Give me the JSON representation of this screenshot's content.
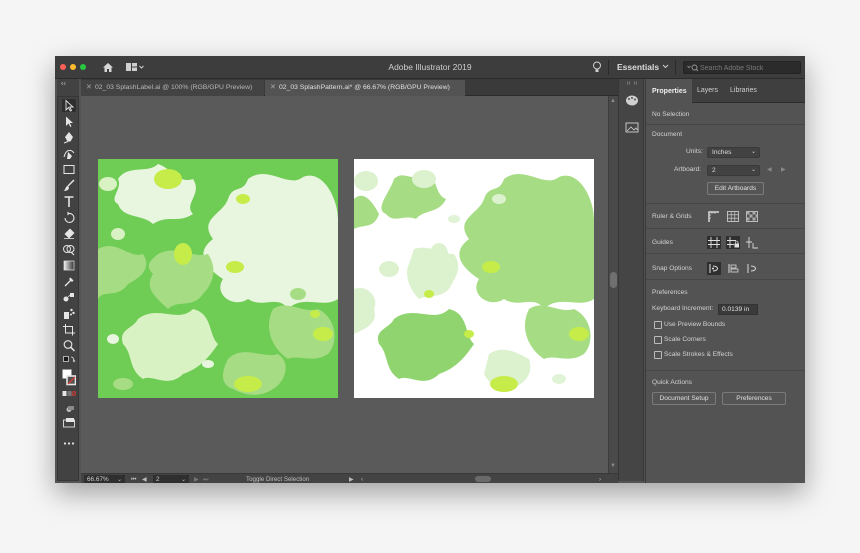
{
  "window": {
    "title": "Adobe Illustrator 2019",
    "workspace": "Essentials",
    "stock_search_placeholder": "Search Adobe Stock"
  },
  "tabs": [
    {
      "label": "02_03 SplashLabel.ai @ 100% (RGB/GPU Preview)",
      "active": false
    },
    {
      "label": "02_03 SplashPattern.ai* @ 66.67% (RGB/GPU Preview)",
      "active": true
    }
  ],
  "tools": [
    "selection-tool",
    "direct-selection-tool",
    "pen-tool",
    "curvature-tool",
    "rectangle-tool",
    "paintbrush-tool",
    "type-tool",
    "rotate-tool",
    "eraser-tool",
    "shape-builder-tool",
    "gradient-tool",
    "eyedropper-tool",
    "blend-tool",
    "symbol-sprayer-tool",
    "artboard-tool",
    "zoom-tool",
    "swap-fill-stroke",
    "fill-stroke-swatch",
    "color-mode-buttons",
    "draw-mode",
    "screen-mode",
    "edit-toolbar"
  ],
  "statusbar": {
    "zoom": "66.67%",
    "artboard_number": "2",
    "status_text": "Toggle Direct Selection"
  },
  "properties": {
    "tabs": [
      "Properties",
      "Layers",
      "Libraries"
    ],
    "selection_state": "No Selection",
    "document_heading": "Document",
    "units_label": "Units:",
    "units_value": "Inches",
    "artboard_label": "Artboard:",
    "artboard_value": "2",
    "edit_artboards": "Edit Artboards",
    "ruler_grids": "Ruler & Grids",
    "guides": "Guides",
    "snap_options": "Snap Options",
    "preferences_heading": "Preferences",
    "keyboard_increment_label": "Keyboard Increment:",
    "keyboard_increment_value": "0.0139 in",
    "checkboxes": [
      "Use Preview Bounds",
      "Scale Corners",
      "Scale Strokes & Effects"
    ],
    "quick_actions_heading": "Quick Actions",
    "document_setup": "Document Setup",
    "preferences_button": "Preferences"
  },
  "colors": {
    "splash_dark": "#6fcc55",
    "splash_mid": "#a6dd84",
    "splash_light": "#dcf2cf",
    "splash_lime": "#c6ec4a",
    "ui_background": "#535353"
  }
}
